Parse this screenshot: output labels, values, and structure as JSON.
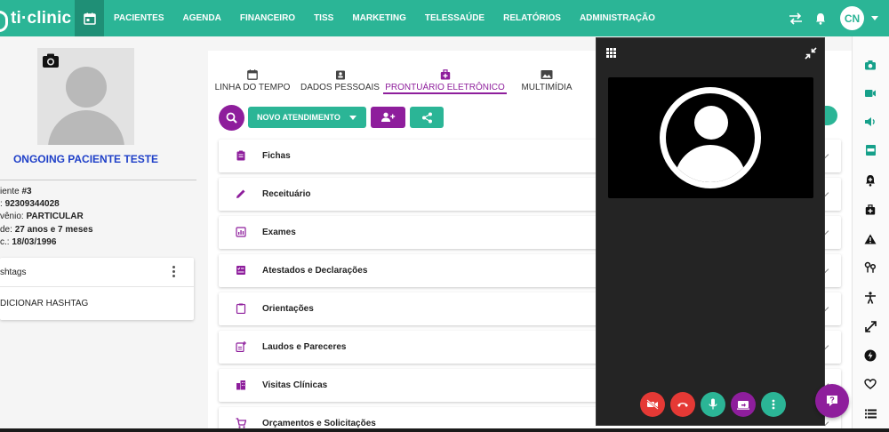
{
  "brand": {
    "name": "ti·clinic"
  },
  "nav": {
    "items": [
      "PACIENTES",
      "AGENDA",
      "FINANCEIRO",
      "TISS",
      "MARKETING",
      "TELESSAÚDE",
      "RELATÓRIOS",
      "ADMINISTRAÇÃO"
    ]
  },
  "user": {
    "initials": "CN"
  },
  "patient": {
    "name": "ONGOING PACIENTE TESTE",
    "fields": [
      {
        "label": "iente ",
        "value": "#3"
      },
      {
        "label": ": ",
        "value": "92309344028"
      },
      {
        "label": "vênio: ",
        "value": "PARTICULAR"
      },
      {
        "label": "de: ",
        "value": "27 anos e 7 meses"
      },
      {
        "label": "c.: ",
        "value": "18/03/1996"
      }
    ]
  },
  "hashtags": {
    "title": "shtags",
    "add_label": "DICIONAR HASHTAG"
  },
  "tabs": [
    {
      "label": "LINHA DO TEMPO",
      "icon": "calendar-icon",
      "active": false
    },
    {
      "label": "DADOS PESSOAIS",
      "icon": "id-badge-icon",
      "active": false
    },
    {
      "label": "PRONTUÁRIO ELETRÔNICO",
      "icon": "medical-bag-icon",
      "active": true
    },
    {
      "label": "MULTIMÍDIA",
      "icon": "image-icon",
      "active": false
    }
  ],
  "actions": {
    "new_visit_label": "NOVO ATENDIMENTO"
  },
  "records": [
    {
      "label": "Fichas",
      "icon": "clipboard-icon"
    },
    {
      "label": "Receituário",
      "icon": "pencil-icon"
    },
    {
      "label": "Exames",
      "icon": "chart-icon"
    },
    {
      "label": "Atestados e Declarações",
      "icon": "checklist-icon"
    },
    {
      "label": "Orientações",
      "icon": "clipboard-outline-icon"
    },
    {
      "label": "Laudos e Pareceres",
      "icon": "note-add-icon"
    },
    {
      "label": "Visitas Clínicas",
      "icon": "building-icon"
    },
    {
      "label": "Orçamentos e Solicitações",
      "icon": "cart-icon"
    }
  ],
  "colors": {
    "primary": "#2bb596",
    "primary_dark": "#1f8f76",
    "accent": "#8e1e9c",
    "danger": "#e53935",
    "name": "#1e3fc8"
  }
}
